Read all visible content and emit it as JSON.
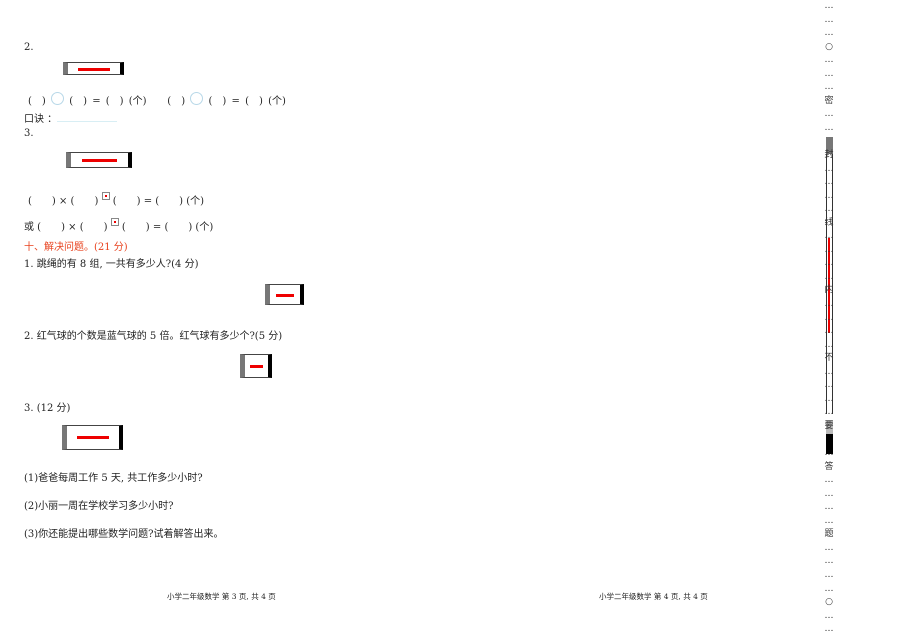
{
  "q2": {
    "num": "2.",
    "row": [
      "(　)",
      "(　)",
      "=",
      "(　)",
      "(个)",
      "(　)",
      "(　)",
      "=",
      "(　)",
      "(个)"
    ],
    "koujue": "口诀 ："
  },
  "q3": {
    "num": "3.",
    "row1": "(　　) × (　　)",
    "row1b": "(　　) = (　　) (个)",
    "row2": "或 (　　) × (　　)",
    "row2b": "(　　) = (　　) (个)"
  },
  "section": {
    "title": "十、解决问题。(21 分)"
  },
  "problems": [
    {
      "text": "1. 跳绳的有 8 组, 一共有多少人?(4 分)"
    },
    {
      "text": "2. 红气球的个数是蓝气球的 5 倍。红气球有多少个?(5 分)"
    },
    {
      "text": "3. (12 分)"
    }
  ],
  "subs": [
    "(1)爸爸每周工作 5 天, 共工作多少小时?",
    "(2)小丽一周在学校学习多少小时?",
    "(3)你还能提出哪些数学问题?试着解答出来。"
  ],
  "footer": {
    "left": "小学二年级数学 第 3 页, 共 4 页",
    "right": "小学二年级数学 第 4 页, 共 4 页"
  },
  "binding": [
    "…",
    "…",
    "…",
    "○",
    "…",
    "…",
    "…",
    "密",
    "…",
    "…",
    "",
    "封",
    "…",
    "…",
    "…",
    "…",
    "线",
    "…",
    "…",
    "…",
    "…",
    "内",
    "…",
    "…",
    "…",
    "…",
    "不",
    "…",
    "…",
    "…",
    "…",
    "要",
    "",
    "…",
    "答",
    "…",
    "…",
    "…",
    "…",
    "题",
    "…",
    "…",
    "…",
    "…",
    "○",
    "…",
    "…"
  ]
}
